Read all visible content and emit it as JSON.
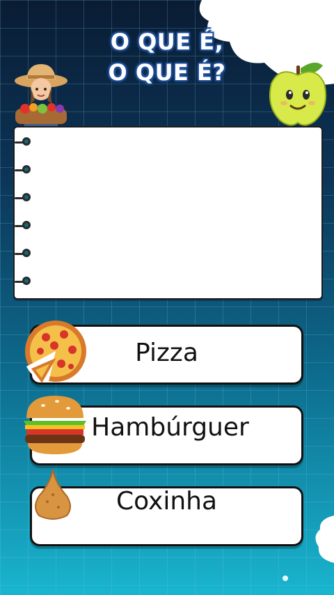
{
  "quiz": {
    "title_line1": "O QUE É,",
    "title_line2": "O QUE É?",
    "riddle_text": ""
  },
  "answers": [
    {
      "label": "Pizza",
      "icon": "pizza-icon"
    },
    {
      "label": "Hambúrguer",
      "icon": "hamburger-icon"
    },
    {
      "label": "Coxinha",
      "icon": "coxinha-icon"
    }
  ],
  "decorations": {
    "farmer": "farmer-emoji-icon",
    "apple": "apple-face-icon"
  },
  "colors": {
    "background_top": "#0a1c33",
    "background_bottom": "#19b5cf",
    "title_outline": "#1a3f7a",
    "ring": "#0f6a78"
  }
}
